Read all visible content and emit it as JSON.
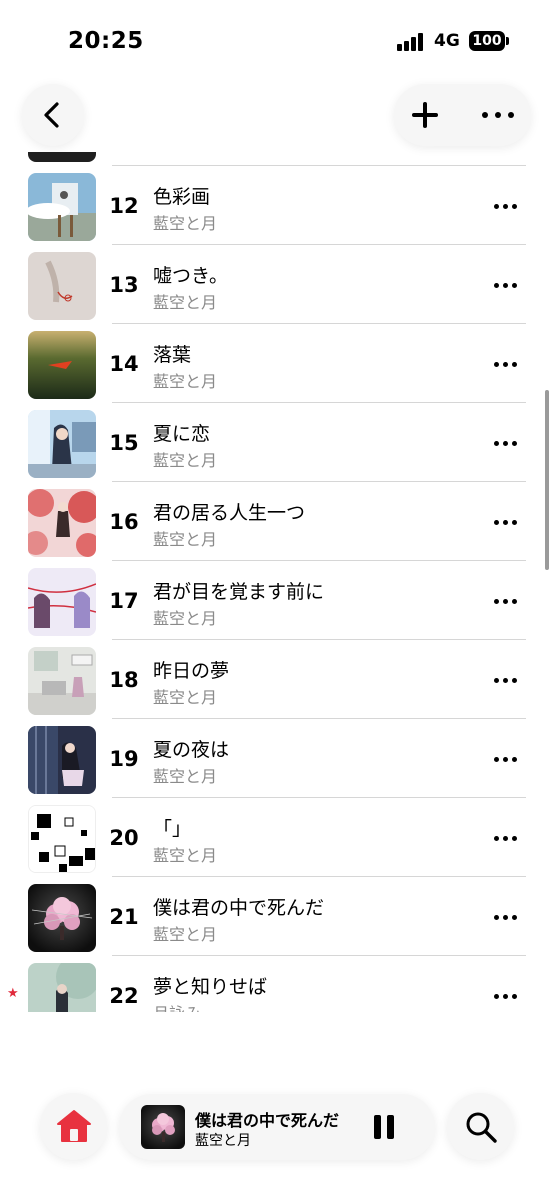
{
  "status_bar": {
    "time": "20:25",
    "network": "4G",
    "battery": "100"
  },
  "header": {
    "back_icon": "chevron-left-icon",
    "add_icon": "plus-icon",
    "more_icon": "ellipsis-icon"
  },
  "tracks": [
    {
      "number": "12",
      "title": "色彩画",
      "artist": "藍空と月",
      "favorite": false
    },
    {
      "number": "13",
      "title": "嘘つき。",
      "artist": "藍空と月",
      "favorite": false
    },
    {
      "number": "14",
      "title": "落葉",
      "artist": "藍空と月",
      "favorite": false
    },
    {
      "number": "15",
      "title": "夏に恋",
      "artist": "藍空と月",
      "favorite": false
    },
    {
      "number": "16",
      "title": "君の居る人生一つ",
      "artist": "藍空と月",
      "favorite": false
    },
    {
      "number": "17",
      "title": "君が目を覚ます前に",
      "artist": "藍空と月",
      "favorite": false
    },
    {
      "number": "18",
      "title": "昨日の夢",
      "artist": "藍空と月",
      "favorite": false
    },
    {
      "number": "19",
      "title": "夏の夜は",
      "artist": "藍空と月",
      "favorite": false
    },
    {
      "number": "20",
      "title": "「」",
      "artist": "藍空と月",
      "favorite": false
    },
    {
      "number": "21",
      "title": "僕は君の中で死んだ",
      "artist": "藍空と月",
      "favorite": false
    },
    {
      "number": "22",
      "title": "夢と知りせば",
      "artist": "月詠み",
      "favorite": true
    }
  ],
  "now_playing": {
    "title": "僕は君の中で死んだ",
    "artist": "藍空と月",
    "state_icon": "pause-icon"
  },
  "bottom_nav": {
    "home_icon": "home-icon",
    "search_icon": "search-icon"
  },
  "colors": {
    "accent": "#e8323f",
    "favorite_star": "#e0293b",
    "secondary_text": "#8a8a8a"
  }
}
